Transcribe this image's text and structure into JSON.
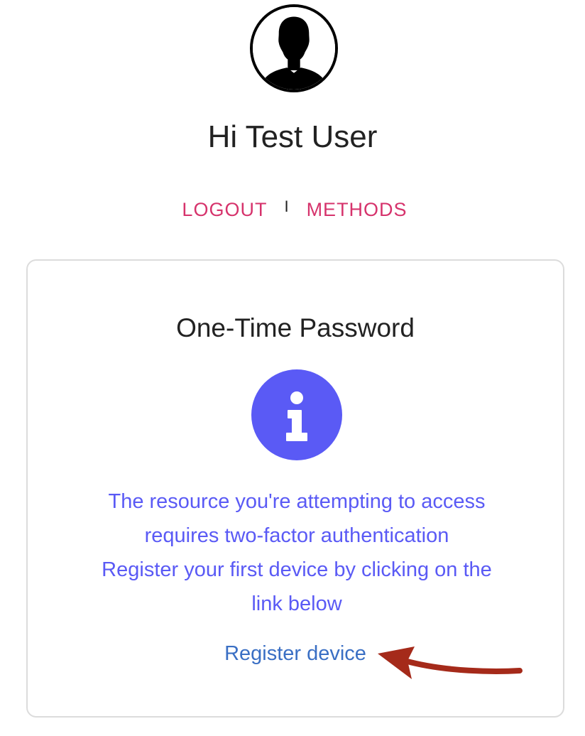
{
  "user": {
    "avatar_icon": "user-silhouette-icon",
    "greeting": "Hi Test User"
  },
  "nav": {
    "logout_label": "LOGOUT",
    "separator": "I",
    "methods_label": "METHODS"
  },
  "card": {
    "title": "One-Time Password",
    "info_icon": "info-icon",
    "message_lines": [
      "The resource you're attempting to access",
      "requires two-factor authentication",
      "Register your first device by clicking on the",
      "link below"
    ],
    "register_link": "Register device"
  },
  "annotation": {
    "arrow_icon": "red-arrow-icon"
  },
  "colors": {
    "nav_link": "#d6336c",
    "accent": "#5a5af5",
    "link": "#3a6fc4",
    "arrow": "#a52a1a"
  }
}
